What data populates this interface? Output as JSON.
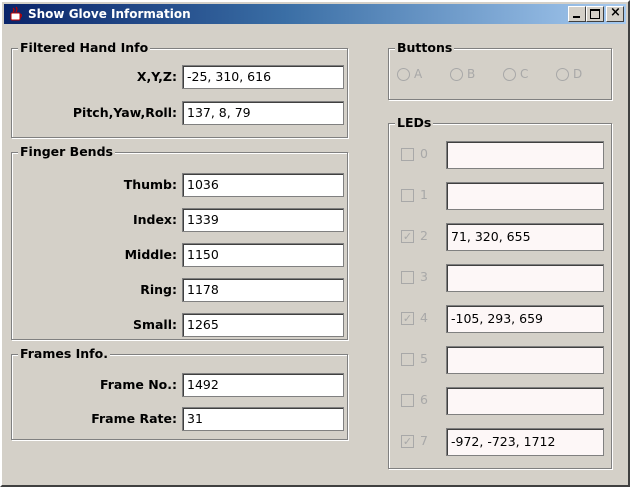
{
  "window": {
    "title": "Show Glove Information"
  },
  "filtered_hand_info": {
    "title": "Filtered Hand Info",
    "fields": [
      {
        "label": "X,Y,Z:",
        "value": "-25, 310, 616"
      },
      {
        "label": "Pitch,Yaw,Roll:",
        "value": "137, 8, 79"
      }
    ]
  },
  "finger_bends": {
    "title": "Finger Bends",
    "fields": [
      {
        "label": "Thumb:",
        "value": "1036"
      },
      {
        "label": "Index:",
        "value": "1339"
      },
      {
        "label": "Middle:",
        "value": "1150"
      },
      {
        "label": "Ring:",
        "value": "1178"
      },
      {
        "label": "Small:",
        "value": "1265"
      }
    ]
  },
  "frames_info": {
    "title": "Frames Info.",
    "fields": [
      {
        "label": "Frame No.:",
        "value": "1492"
      },
      {
        "label": "Frame Rate:",
        "value": "31"
      }
    ]
  },
  "buttons": {
    "title": "Buttons",
    "options": [
      "A",
      "B",
      "C",
      "D"
    ]
  },
  "leds": {
    "title": "LEDs",
    "items": [
      {
        "label": "0",
        "checked": false,
        "value": ""
      },
      {
        "label": "1",
        "checked": false,
        "value": ""
      },
      {
        "label": "2",
        "checked": true,
        "value": "71, 320, 655"
      },
      {
        "label": "3",
        "checked": false,
        "value": ""
      },
      {
        "label": "4",
        "checked": true,
        "value": "-105, 293, 659"
      },
      {
        "label": "5",
        "checked": false,
        "value": ""
      },
      {
        "label": "6",
        "checked": false,
        "value": ""
      },
      {
        "label": "7",
        "checked": true,
        "value": "-972, -723, 1712"
      }
    ]
  }
}
